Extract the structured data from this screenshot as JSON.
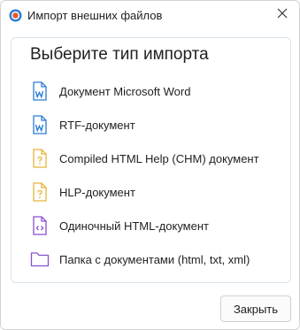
{
  "window": {
    "title": "Импорт внешних файлов",
    "app_icon": "app-icon",
    "close_icon": "close-icon"
  },
  "panel": {
    "title": "Выберите тип импорта",
    "options": [
      {
        "label": "Документ Microsoft Word",
        "icon": "word-document-icon",
        "color": "#2b7cd3"
      },
      {
        "label": "RTF-документ",
        "icon": "rtf-document-icon",
        "color": "#2b7cd3"
      },
      {
        "label": "Compiled HTML Help (CHM) документ",
        "icon": "chm-help-icon",
        "color": "#e8b33a"
      },
      {
        "label": "HLP-документ",
        "icon": "hlp-help-icon",
        "color": "#e8b33a"
      },
      {
        "label": "Одиночный HTML-документ",
        "icon": "html-document-icon",
        "color": "#8a4fd1"
      },
      {
        "label": "Папка с документами (html, txt, xml)",
        "icon": "folder-icon",
        "color": "#8a4fd1"
      }
    ]
  },
  "footer": {
    "close_label": "Закрыть"
  }
}
